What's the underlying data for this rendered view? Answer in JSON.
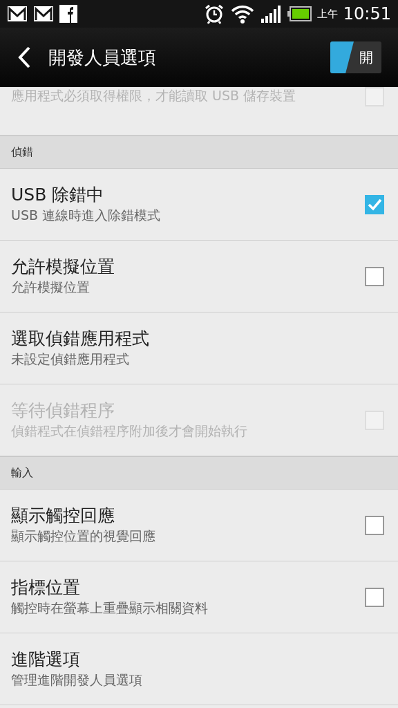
{
  "status_bar": {
    "am_pm": "上午",
    "time": "10:51"
  },
  "action_bar": {
    "title": "開發人員選項",
    "toggle": {
      "label": "開",
      "on": true
    }
  },
  "items": [
    {
      "kind": "checkbox",
      "summary": "應用程式必須取得權限，才能讀取 USB 儲存裝置",
      "disabled": true,
      "checked": false
    },
    {
      "kind": "header",
      "title": "偵錯"
    },
    {
      "kind": "checkbox",
      "title": "USB 除錯中",
      "summary": "USB 連線時進入除錯模式",
      "disabled": false,
      "checked": true
    },
    {
      "kind": "checkbox",
      "title": "允許模擬位置",
      "summary": "允許模擬位置",
      "disabled": false,
      "checked": false
    },
    {
      "kind": "plain",
      "title": "選取偵錯應用程式",
      "summary": "未設定偵錯應用程式",
      "disabled": false
    },
    {
      "kind": "checkbox",
      "title": "等待偵錯程序",
      "summary": "偵錯程式在偵錯程序附加後才會開始執行",
      "disabled": true,
      "checked": false
    },
    {
      "kind": "header",
      "title": "輸入"
    },
    {
      "kind": "checkbox",
      "title": "顯示觸控回應",
      "summary": "顯示觸控位置的視覺回應",
      "disabled": false,
      "checked": false
    },
    {
      "kind": "checkbox",
      "title": "指標位置",
      "summary": "觸控時在螢幕上重疊顯示相關資料",
      "disabled": false,
      "checked": false
    },
    {
      "kind": "plain",
      "title": "進階選項",
      "summary": "管理進階開發人員選項",
      "disabled": false
    }
  ]
}
